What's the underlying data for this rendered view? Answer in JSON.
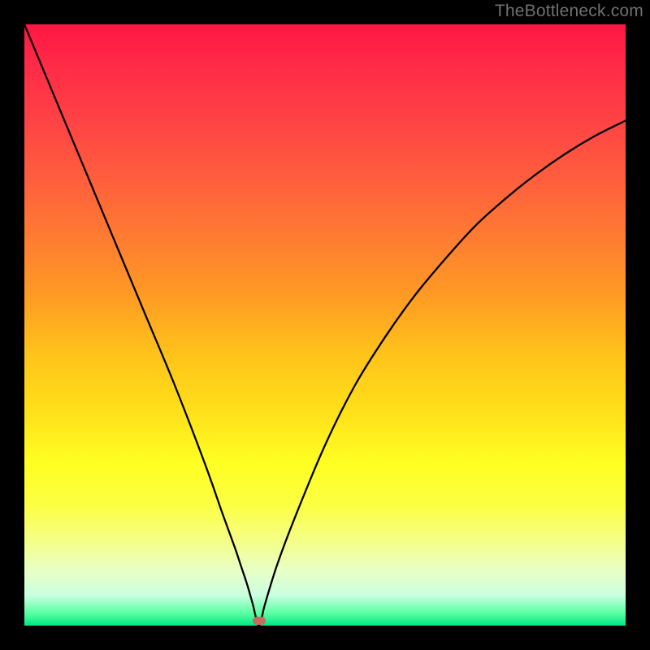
{
  "watermark": "TheBottleneck.com",
  "chart_data": {
    "type": "line",
    "title": "",
    "xlabel": "",
    "ylabel": "",
    "xlim": [
      0,
      100
    ],
    "ylim": [
      0,
      100
    ],
    "grid": false,
    "series": [
      {
        "name": "bottleneck-curve",
        "x": [
          0,
          5,
          10,
          15,
          20,
          25,
          30,
          33,
          35,
          36,
          37,
          38,
          38.5,
          39,
          39.5,
          40,
          42,
          45,
          50,
          55,
          60,
          65,
          70,
          75,
          80,
          85,
          90,
          95,
          100
        ],
        "values": [
          100,
          88,
          76,
          64,
          52,
          40,
          27,
          18.5,
          13,
          10,
          7,
          3.5,
          1.4,
          0,
          1.4,
          3.5,
          10,
          18,
          30,
          40,
          48,
          55,
          61,
          66.5,
          71,
          75,
          78.5,
          81.5,
          84
        ]
      }
    ],
    "annotations": [
      {
        "name": "optimum-marker",
        "x": 39,
        "y": 0.8,
        "color": "#c96a5f"
      }
    ],
    "background_gradient": {
      "stops": [
        {
          "pos": 0,
          "color": "#ff1744"
        },
        {
          "pos": 50,
          "color": "#ffc31a"
        },
        {
          "pos": 75,
          "color": "#ffff22"
        },
        {
          "pos": 100,
          "color": "#00e585"
        }
      ]
    }
  }
}
